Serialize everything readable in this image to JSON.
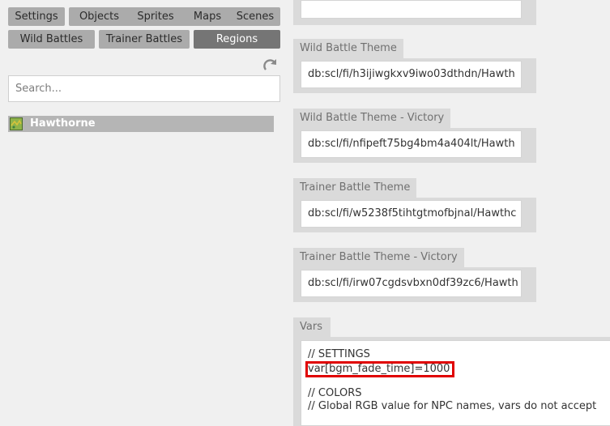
{
  "tabs": [
    {
      "label": "Settings",
      "active": false
    },
    {
      "label": "Objects",
      "active": false
    },
    {
      "label": "Sprites",
      "active": false
    },
    {
      "label": "Maps",
      "active": false
    },
    {
      "label": "Scenes",
      "active": false
    },
    {
      "label": "Wild Battles",
      "active": false
    },
    {
      "label": "Trainer Battles",
      "active": false
    },
    {
      "label": "Regions",
      "active": true
    }
  ],
  "search": {
    "placeholder": "Search..."
  },
  "list": [
    {
      "label": "Hawthorne",
      "icon": "map-icon"
    }
  ],
  "sections": [
    {
      "title": "Wild Battle Theme",
      "value": "db:scl/fi/h3ijiwgkxv9iwo03dthdn/Hawth"
    },
    {
      "title": "Wild Battle Theme - Victory",
      "value": "db:scl/fi/nfipeft75bg4bm4a404lt/Hawth"
    },
    {
      "title": "Trainer Battle Theme",
      "value": "db:scl/fi/w5238f5tihtgtmofbjnal/Hawthc"
    },
    {
      "title": "Trainer Battle Theme - Victory",
      "value": "db:scl/fi/irw07cgdsvbxn0df39zc6/Hawth"
    }
  ],
  "vars": {
    "title": "Vars",
    "lines": [
      "// SETTINGS",
      "var[bgm_fade_time]=1000",
      "",
      "// COLORS",
      "// Global RGB value for NPC names, vars do not accept"
    ]
  },
  "colors": {
    "tab_bg": "#ababab",
    "tab_active_bg": "#757575",
    "highlight": "#e00000"
  },
  "icons": {
    "refresh": "refresh-icon"
  }
}
